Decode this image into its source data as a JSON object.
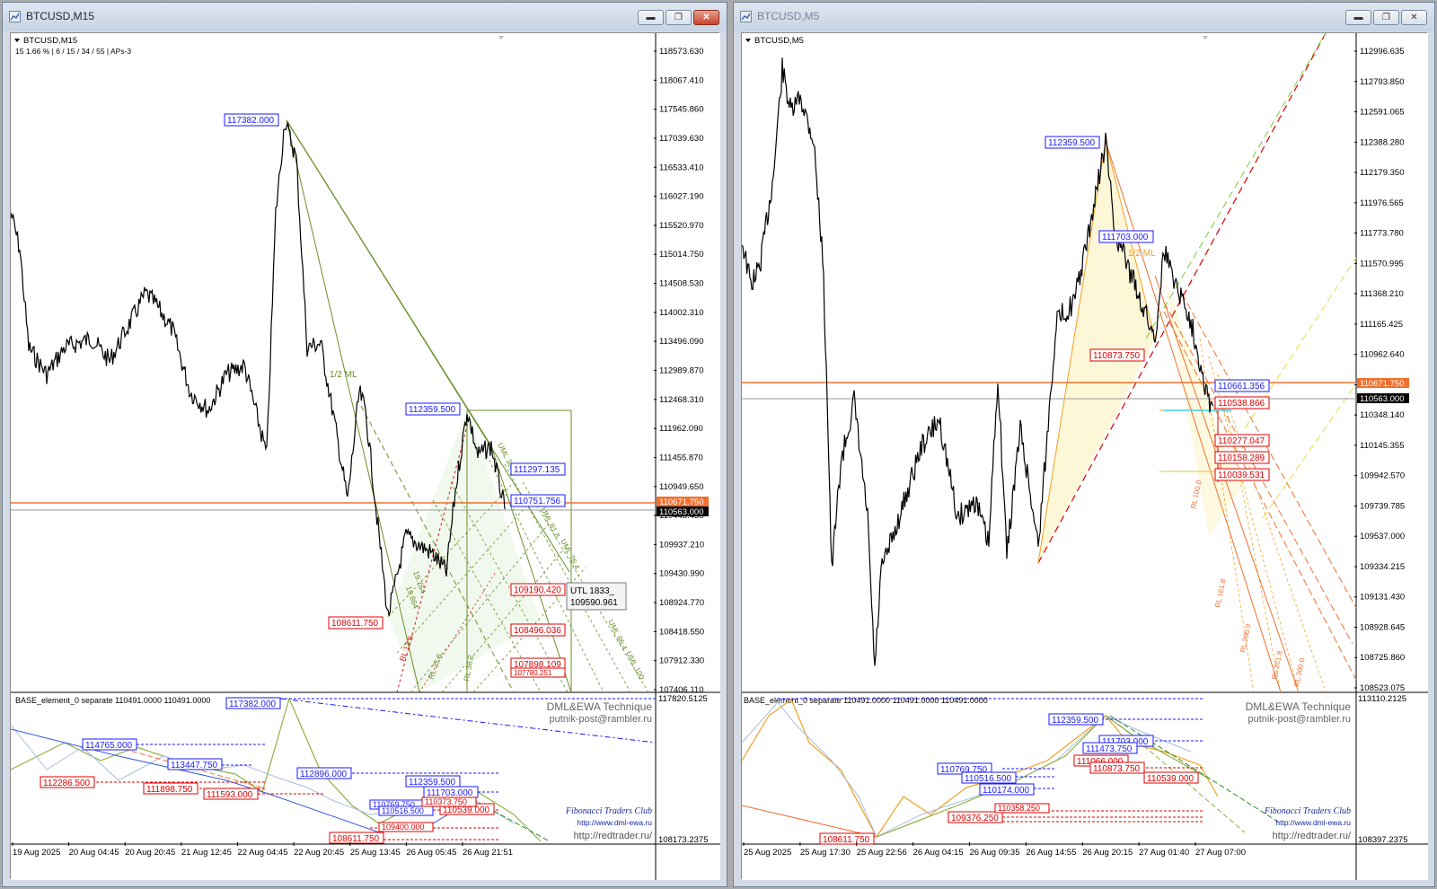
{
  "left": {
    "window_title": "BTCUSD,M15",
    "chart_label": "BTCUSD,M15",
    "info_line": "15  1.66 %  |  6 / 15 / 34 / 55  |  APs-3",
    "price_scale": [
      "118573.630",
      "118067.410",
      "117545.860",
      "117039.630",
      "116533.410",
      "116027.190",
      "115520.970",
      "115014.750",
      "114508.530",
      "114002.310",
      "113496.090",
      "112989.870",
      "112468.310",
      "111962.090",
      "111455.870",
      "110949.650",
      "110443.430",
      "109937.210",
      "109430.990",
      "108924.770",
      "108418.550",
      "107912.330",
      "107406.110"
    ],
    "current_prices": {
      "upper": "110671.750",
      "lower": "110563.000"
    },
    "main_labels": {
      "high": "117382.000",
      "swing_high": "112359.500",
      "lvl1": "111297.135",
      "lvl2": "110751.756",
      "low": "108611.750",
      "lvl3": "109190.420",
      "lvl4": "108496.036",
      "lvl5": "107898.109",
      "lvl6": "107780.251"
    },
    "fib_texts": {
      "half_ml": "1/2 ML",
      "r764": "19.764",
      "r864": "19.864",
      "rl136": "RL 13.6",
      "rl256": "RL 25.6",
      "rl382": "RL 38.2",
      "uml1": "UML 38.2",
      "uml2": "UML 61.8",
      "uml3": "UML 76.4",
      "uml4": "UML 86.4",
      "uml5": "UML 100"
    },
    "tooltip": {
      "line1": "UTL 1833_",
      "line2": "109590.961"
    },
    "sub": {
      "label": "BASE_element_0 separate 110491.0000 110491.0000",
      "brand1": "DML&EWA Technique",
      "brand2": "putnik-post@rambler.ru",
      "brand3": "Fibonacci Traders Club",
      "brand4": "http://www.dml-ewa.ru",
      "brand5": "http://redtrader.ru/",
      "scale_top": "117820.5125",
      "scale_bot": "108173.2375",
      "blue_labels": [
        "117382.000",
        "114765.000",
        "113447.750",
        "112896.000",
        "112359.500",
        "111703.000",
        "110769.750",
        "110516.500"
      ],
      "red_labels": [
        "112286.500",
        "111898.750",
        "111593.000",
        "110539.000",
        "110373.750",
        "108611.750",
        "109400.000"
      ]
    },
    "time_axis": [
      "19 Aug 2025",
      "20 Aug 04:45",
      "20 Aug 20:45",
      "21 Aug 12:45",
      "22 Aug 04:45",
      "22 Aug 20:45",
      "25 Aug 13:45",
      "26 Aug 05:45",
      "26 Aug 21:51"
    ]
  },
  "right": {
    "window_title": "BTCUSD,M5",
    "chart_label": "BTCUSD,M5",
    "price_scale": [
      "112996.635",
      "112793.850",
      "112591.065",
      "112388.280",
      "112179.350",
      "111976.565",
      "111773.780",
      "111570.995",
      "111368.210",
      "111165.425",
      "110962.640",
      "110759.855",
      "110348.140",
      "110145.355",
      "109942.570",
      "109739.785",
      "109537.000",
      "109334.215",
      "109131.430",
      "108928.645",
      "108725.860",
      "108523.075"
    ],
    "current_prices": {
      "upper": "110671.750",
      "lower": "110563.000"
    },
    "main_labels": {
      "high": "112359.500",
      "mid": "111703.000",
      "low_mark": "110873.750",
      "b1": "110661.356",
      "r1": "110538.866",
      "r2": "110277.047",
      "r3": "110158.289",
      "r4": "110039.531"
    },
    "fib_texts": {
      "half_ml": "1/2 ML",
      "rl1": "RL 161.8",
      "rl2": "RL 200.0",
      "rl3": "RL 261.8",
      "rl4": "RL 300.0",
      "rl5": "RL 100.0"
    },
    "sub": {
      "label": "BASE_element_0 separate 110491.0000 110491.0000 110491.0000",
      "brand1": "DML&EWA Technique",
      "brand2": "putnik-post@rambler.ru",
      "brand3": "Fibonacci Traders Club",
      "brand4": "http://www.dml-ewa.ru",
      "brand5": "http://redtrader.ru/",
      "scale_top": "113110.2125",
      "scale_bot": "108397.2375",
      "blue_labels": [
        "112359.500",
        "111703.000",
        "111473.750",
        "110769.750",
        "110516.500",
        "110174.000"
      ],
      "red_labels": [
        "111066.000",
        "110873.750",
        "110539.000",
        "108611.750",
        "109376.250",
        "110358.250"
      ]
    },
    "time_axis": [
      "25 Aug 2025",
      "25 Aug 17:30",
      "25 Aug 22:56",
      "26 Aug 04:15",
      "26 Aug 09:35",
      "26 Aug 14:55",
      "26 Aug 20:15",
      "27 Aug 01:40",
      "27 Aug 07:00"
    ]
  }
}
